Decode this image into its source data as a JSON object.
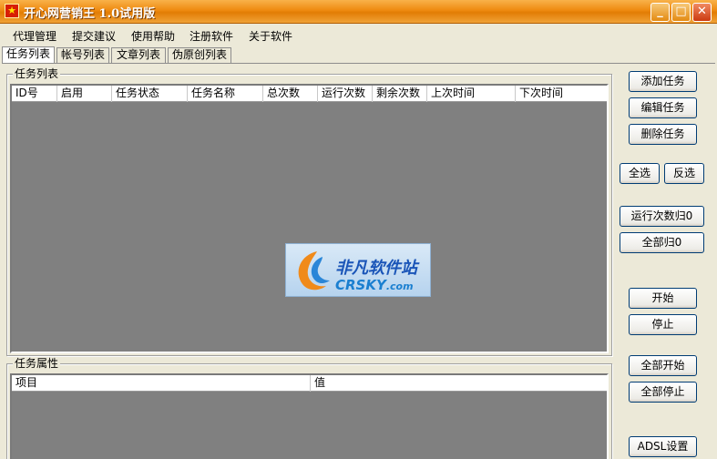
{
  "window": {
    "title": "开心网营销王 1.0试用版",
    "icon": "star-app-icon",
    "controls": {
      "minimize": "_",
      "maximize": "□",
      "close": "✕"
    }
  },
  "menu": [
    "代理管理",
    "提交建议",
    "使用帮助",
    "注册软件",
    "关于软件"
  ],
  "tabs": [
    "任务列表",
    "帐号列表",
    "文章列表",
    "伪原创列表"
  ],
  "task_group": {
    "legend": "任务列表",
    "columns": [
      "ID号",
      "启用",
      "任务状态",
      "任务名称",
      "总次数",
      "运行次数",
      "剩余次数",
      "上次时间",
      "下次时间"
    ]
  },
  "prop_group": {
    "legend": "任务属性",
    "columns": [
      "项目",
      "值"
    ]
  },
  "buttons": {
    "add": "添加任务",
    "edit": "编辑任务",
    "delete": "删除任务",
    "select_all": "全选",
    "invert": "反选",
    "reset_runs": "运行次数归0",
    "reset_all": "全部归0",
    "start": "开始",
    "stop": "停止",
    "start_all": "全部开始",
    "stop_all": "全部停止",
    "adsl": "ADSL设置"
  },
  "watermark": {
    "cn": "非凡软件站",
    "en_main": "CRSKY",
    "en_suffix": ".com"
  },
  "colors": {
    "title_bar": "#ee8a10",
    "list_bg": "#808080",
    "window_bg": "#ece9d8"
  }
}
